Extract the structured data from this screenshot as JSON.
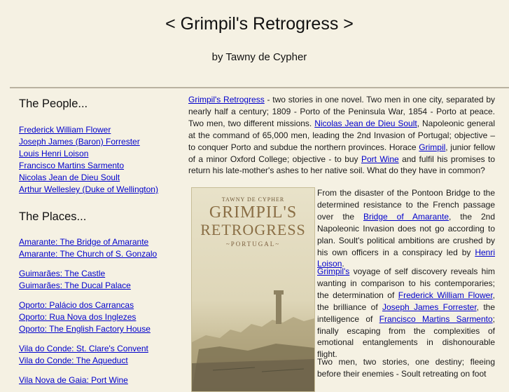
{
  "header": {
    "title": "< Grimpil's Retrogress >",
    "byline": "by Tawny de Cypher"
  },
  "sidebar": {
    "people_heading": "The People...",
    "people": [
      "Frederick William Flower",
      "Joseph James (Baron) Forrester",
      "Louis Henri Loison",
      "Francisco Martins Sarmento",
      "Nicolas Jean de Dieu Soult",
      "Arthur Wellesley (Duke of Wellington)"
    ],
    "places_heading": "The Places...",
    "places_groups": [
      [
        "Amarante: The Bridge of Amarante",
        "Amarante: The Church of S. Gonzalo"
      ],
      [
        "Guimarães: The Castle",
        "Guimarães: The Ducal Palace"
      ],
      [
        "Oporto: Palácio dos Carrancas",
        "Oporto: Rua Nova dos Inglezes",
        "Oporto: The English Factory House"
      ],
      [
        "Vila do Conde: St. Clare's Convent",
        "Vila do Conde: The Aqueduct"
      ],
      [
        "Vila Nova de Gaia: Port Wine"
      ]
    ]
  },
  "cover": {
    "author": "TAWNY DE CYPHER",
    "title_line1": "GRIMPIL'S",
    "title_line2": "RETROGRESS",
    "subtitle": "~PORTUGAL~"
  },
  "intro": {
    "link_title": "Grimpil's Retrogress",
    "t1": " - two stories in one novel. Two men in one city, separated by nearly half a century; 1809 - Porto of the Peninsula War, 1854 - Porto at peace. Two men, two different missions. ",
    "link_soult": "Nicolas Jean de Dieu Soult",
    "t2": ", Napoleonic general at the command of 65,000 men, leading the 2nd Invasion of Portugal; objective – to conquer Porto and subdue the northern provinces. Horace ",
    "link_grimpil": "Grimpil",
    "t3": ", junior fellow of a minor Oxford College; objective - to buy ",
    "link_port": "Port Wine",
    "t4": " and fulfil his promises to return his late-mother's ashes to her native soil. What do they have in common?"
  },
  "para2": {
    "t1": "From the disaster of the Pontoon Bridge to the determined resistance to the French passage over the ",
    "link_bridge": "Bridge of Amarante",
    "t2": ", the 2nd Napoleonic Invasion does not go according to plan. Soult's political ambitions are crushed by his own officers in a conspiracy led by ",
    "link_loison": "Henri Loison",
    "t3": "."
  },
  "para3": {
    "link_grimpils": "Grimpil's",
    "t1": " voyage of self discovery reveals him wanting in comparison to his contemporaries; the determination of ",
    "link_flower": "Frederick William Flower",
    "t2": ", the brilliance of ",
    "link_forrester": "Joseph James Forrester",
    "t3": ", the intelligence of ",
    "link_sarmento": "Francisco Martins Sarmento",
    "t4": "; finally escaping from the complexities of emotional entanglements in dishonourable flight."
  },
  "para4": {
    "t1": "Two men, two stories, one destiny; fleeing before their enemies - Soult retreating on foot"
  }
}
